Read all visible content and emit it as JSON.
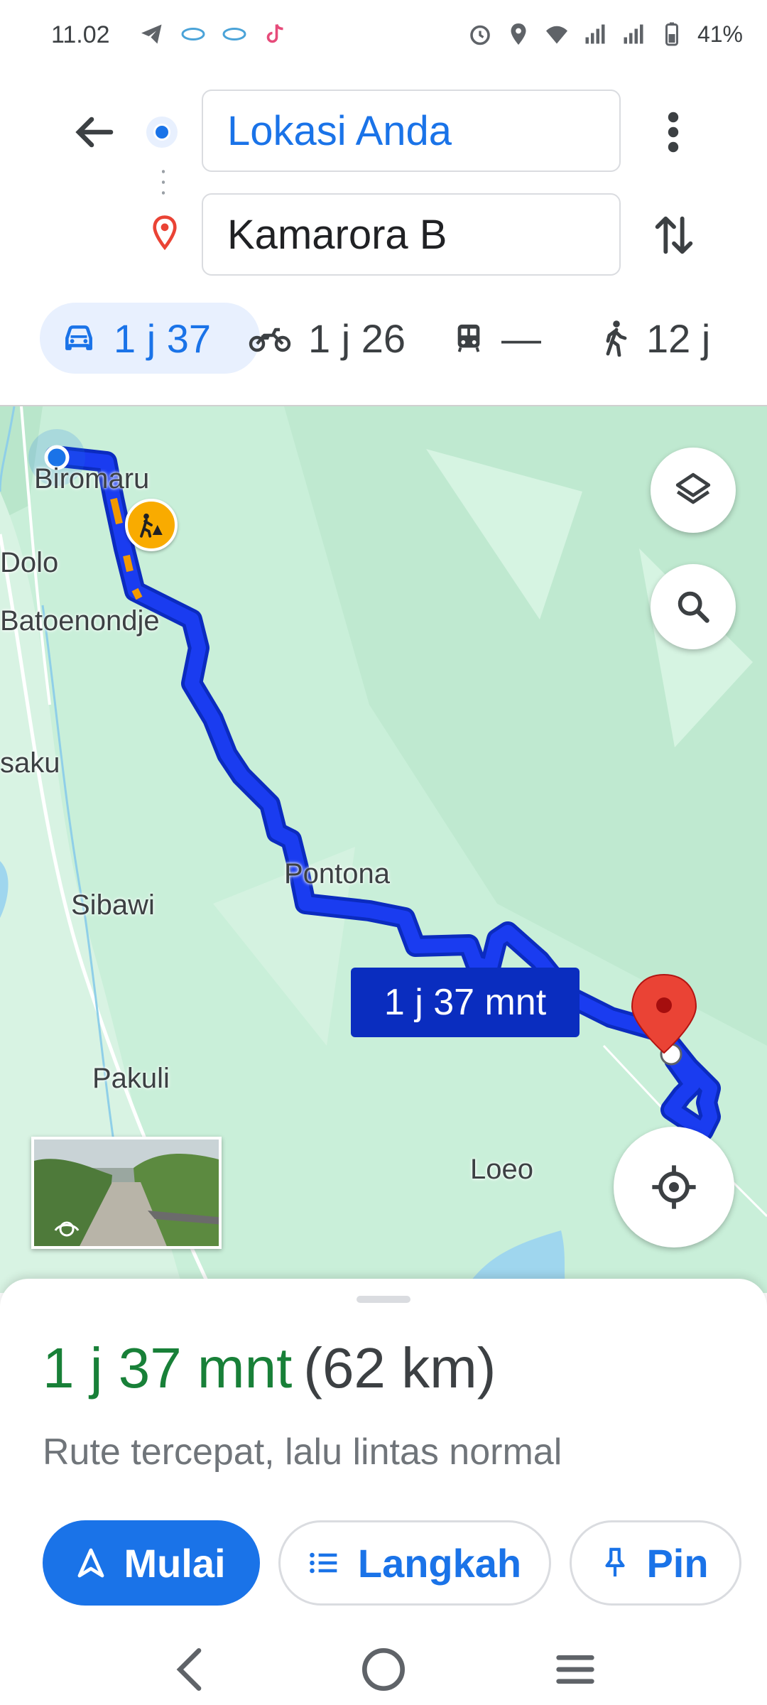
{
  "status_bar": {
    "time": "11.02",
    "battery": "41%",
    "icons_left": [
      "telegram-icon",
      "app-icon",
      "app-icon",
      "tiktok-icon"
    ],
    "icons_right": [
      "alarm-icon",
      "location-icon",
      "wifi-icon",
      "signal-icon",
      "signal-icon",
      "battery-icon"
    ]
  },
  "search": {
    "origin": "Lokasi Anda",
    "destination": "Kamarora B"
  },
  "modes": [
    {
      "icon": "car-icon",
      "label": "1 j 37",
      "active": true
    },
    {
      "icon": "motorcycle-icon",
      "label": "1 j 26",
      "active": false
    },
    {
      "icon": "transit-icon",
      "label": "—",
      "active": false
    },
    {
      "icon": "walk-icon",
      "label": "12 j",
      "active": false
    }
  ],
  "map": {
    "places": [
      "Biromaru",
      "Dolo",
      "Batoenondje",
      "saku",
      "Pontona",
      "Sibawi",
      "Pakuli",
      "Loeo"
    ],
    "route_eta": "1 j 37 mnt",
    "colors": {
      "route": "#1a3cf0",
      "route_outline": "#0b2bbf",
      "land": "#c9efd9",
      "water": "#9fd6ee",
      "pin": "#ea4335"
    }
  },
  "sheet": {
    "duration": "1 j 37 mnt",
    "distance": "(62 km)",
    "note": "Rute tercepat, lalu lintas normal",
    "buttons": {
      "start": "Mulai",
      "steps": "Langkah",
      "pin": "Pin"
    }
  },
  "colors": {
    "accent": "#1a73e8",
    "duration_green": "#188038"
  }
}
